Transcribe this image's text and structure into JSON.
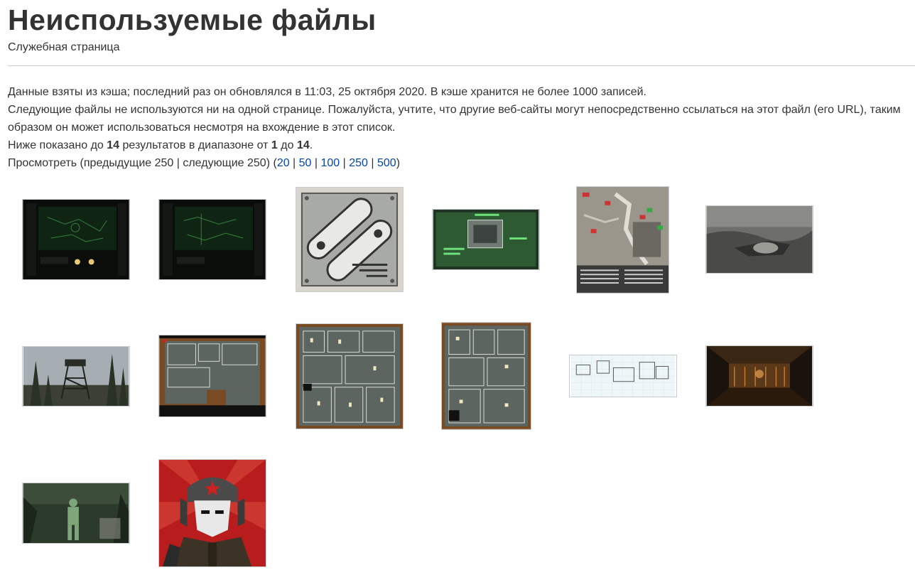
{
  "page": {
    "title": "Неиспользуемые файлы",
    "subtitle": "Служебная страница"
  },
  "info": {
    "cache_line": "Данные взяты из кэша; последний раз он обновлялся в 11:03, 25 октября 2020. В кэше хранится не более 1000 записей.",
    "notice_line": "Следующие файлы не используются ни на одной странице. Пожалуйста, учтите, что другие веб-сайты могут непосредственно ссылаться на этот файл (его URL), таким образом он может использоваться несмотря на вхождение в этот список.",
    "results_prefix": "Ниже показано до ",
    "results_count": "14",
    "results_mid": " результатов в диапазоне от ",
    "results_from": "1",
    "results_to_word": " до ",
    "results_to": "14",
    "results_end": "."
  },
  "pagination": {
    "prefix": "Просмотреть (предыдущие 250 | следующие 250) (",
    "limits": [
      "20",
      "50",
      "100",
      "250",
      "500"
    ],
    "separator": " | ",
    "suffix": ")"
  },
  "gallery": {
    "count": 14,
    "items": [
      {
        "icon": "pipboy-map-green"
      },
      {
        "icon": "pipboy-map-green"
      },
      {
        "icon": "metal-panel"
      },
      {
        "icon": "pipboy-item-green"
      },
      {
        "icon": "fort-map"
      },
      {
        "icon": "wasteland-grey"
      },
      {
        "icon": "watchtower-forest"
      },
      {
        "icon": "floorplan-brown"
      },
      {
        "icon": "floorplan-grey"
      },
      {
        "icon": "floorplan-grey-2"
      },
      {
        "icon": "blueprint-sketch"
      },
      {
        "icon": "interior-wooden"
      },
      {
        "icon": "soldier-forest"
      },
      {
        "icon": "red-soldier-portrait"
      }
    ]
  },
  "colors": {
    "link": "#0645ad",
    "rule": "#c8ccd1",
    "heading": "#333333"
  }
}
